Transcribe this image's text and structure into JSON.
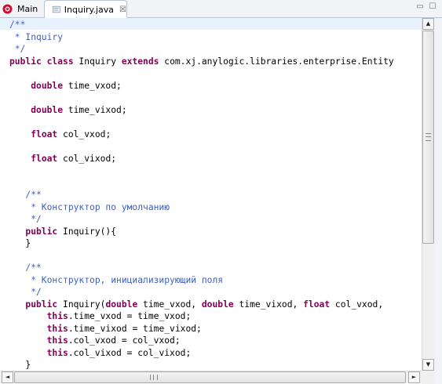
{
  "tabs": [
    {
      "label": "Main",
      "icon": "anylogic-logo-icon"
    },
    {
      "label": "Inquiry.java",
      "icon": "java-file-icon",
      "active": true
    }
  ],
  "window_controls": {
    "minimize": "▭",
    "maximize": "☐"
  },
  "scrollbars": {
    "up": "▲",
    "down": "▼",
    "left": "◄",
    "right": "►"
  },
  "colors": {
    "comment": "#3f5fbf",
    "keyword": "#7f0055",
    "text": "#000000",
    "current_line": "#e8f2fe"
  },
  "code_lines": [
    [
      {
        "t": "cm",
        "v": "/**"
      }
    ],
    [
      {
        "t": "cm",
        "v": " * Inquiry"
      }
    ],
    [
      {
        "t": "cm",
        "v": " */"
      }
    ],
    [
      {
        "t": "kw",
        "v": "public class "
      },
      {
        "t": "pl",
        "v": "Inquiry "
      },
      {
        "t": "kw",
        "v": "extends "
      },
      {
        "t": "pl",
        "v": "com.xj.anylogic.libraries.enterprise.Entity"
      }
    ],
    [],
    [
      {
        "t": "pl",
        "v": "    "
      },
      {
        "t": "kw",
        "v": "double "
      },
      {
        "t": "pl",
        "v": "time_vxod;"
      }
    ],
    [],
    [
      {
        "t": "pl",
        "v": "    "
      },
      {
        "t": "kw",
        "v": "double "
      },
      {
        "t": "pl",
        "v": "time_vixod;"
      }
    ],
    [],
    [
      {
        "t": "pl",
        "v": "    "
      },
      {
        "t": "kw",
        "v": "float "
      },
      {
        "t": "pl",
        "v": "col_vxod;"
      }
    ],
    [],
    [
      {
        "t": "pl",
        "v": "    "
      },
      {
        "t": "kw",
        "v": "float "
      },
      {
        "t": "pl",
        "v": "col_vixod;"
      }
    ],
    [],
    [],
    [
      {
        "t": "cm",
        "v": "   /**"
      }
    ],
    [
      {
        "t": "cm",
        "v": "    * Конструктор по умолчанию"
      }
    ],
    [
      {
        "t": "cm",
        "v": "    */"
      }
    ],
    [
      {
        "t": "pl",
        "v": "   "
      },
      {
        "t": "kw",
        "v": "public "
      },
      {
        "t": "pl",
        "v": "Inquiry(){"
      }
    ],
    [
      {
        "t": "pl",
        "v": "   }"
      }
    ],
    [],
    [
      {
        "t": "cm",
        "v": "   /**"
      }
    ],
    [
      {
        "t": "cm",
        "v": "    * Конструктор, инициализирующий поля"
      }
    ],
    [
      {
        "t": "cm",
        "v": "    */"
      }
    ],
    [
      {
        "t": "pl",
        "v": "   "
      },
      {
        "t": "kw",
        "v": "public "
      },
      {
        "t": "pl",
        "v": "Inquiry("
      },
      {
        "t": "kw",
        "v": "double "
      },
      {
        "t": "pl",
        "v": "time_vxod, "
      },
      {
        "t": "kw",
        "v": "double "
      },
      {
        "t": "pl",
        "v": "time_vixod, "
      },
      {
        "t": "kw",
        "v": "float "
      },
      {
        "t": "pl",
        "v": "col_vxod, "
      }
    ],
    [
      {
        "t": "pl",
        "v": "       "
      },
      {
        "t": "kw",
        "v": "this"
      },
      {
        "t": "pl",
        "v": ".time_vxod = time_vxod;"
      }
    ],
    [
      {
        "t": "pl",
        "v": "       "
      },
      {
        "t": "kw",
        "v": "this"
      },
      {
        "t": "pl",
        "v": ".time_vixod = time_vixod;"
      }
    ],
    [
      {
        "t": "pl",
        "v": "       "
      },
      {
        "t": "kw",
        "v": "this"
      },
      {
        "t": "pl",
        "v": ".col_vxod = col_vxod;"
      }
    ],
    [
      {
        "t": "pl",
        "v": "       "
      },
      {
        "t": "kw",
        "v": "this"
      },
      {
        "t": "pl",
        "v": ".col_vixod = col_vixod;"
      }
    ],
    [
      {
        "t": "pl",
        "v": "   }"
      }
    ]
  ]
}
